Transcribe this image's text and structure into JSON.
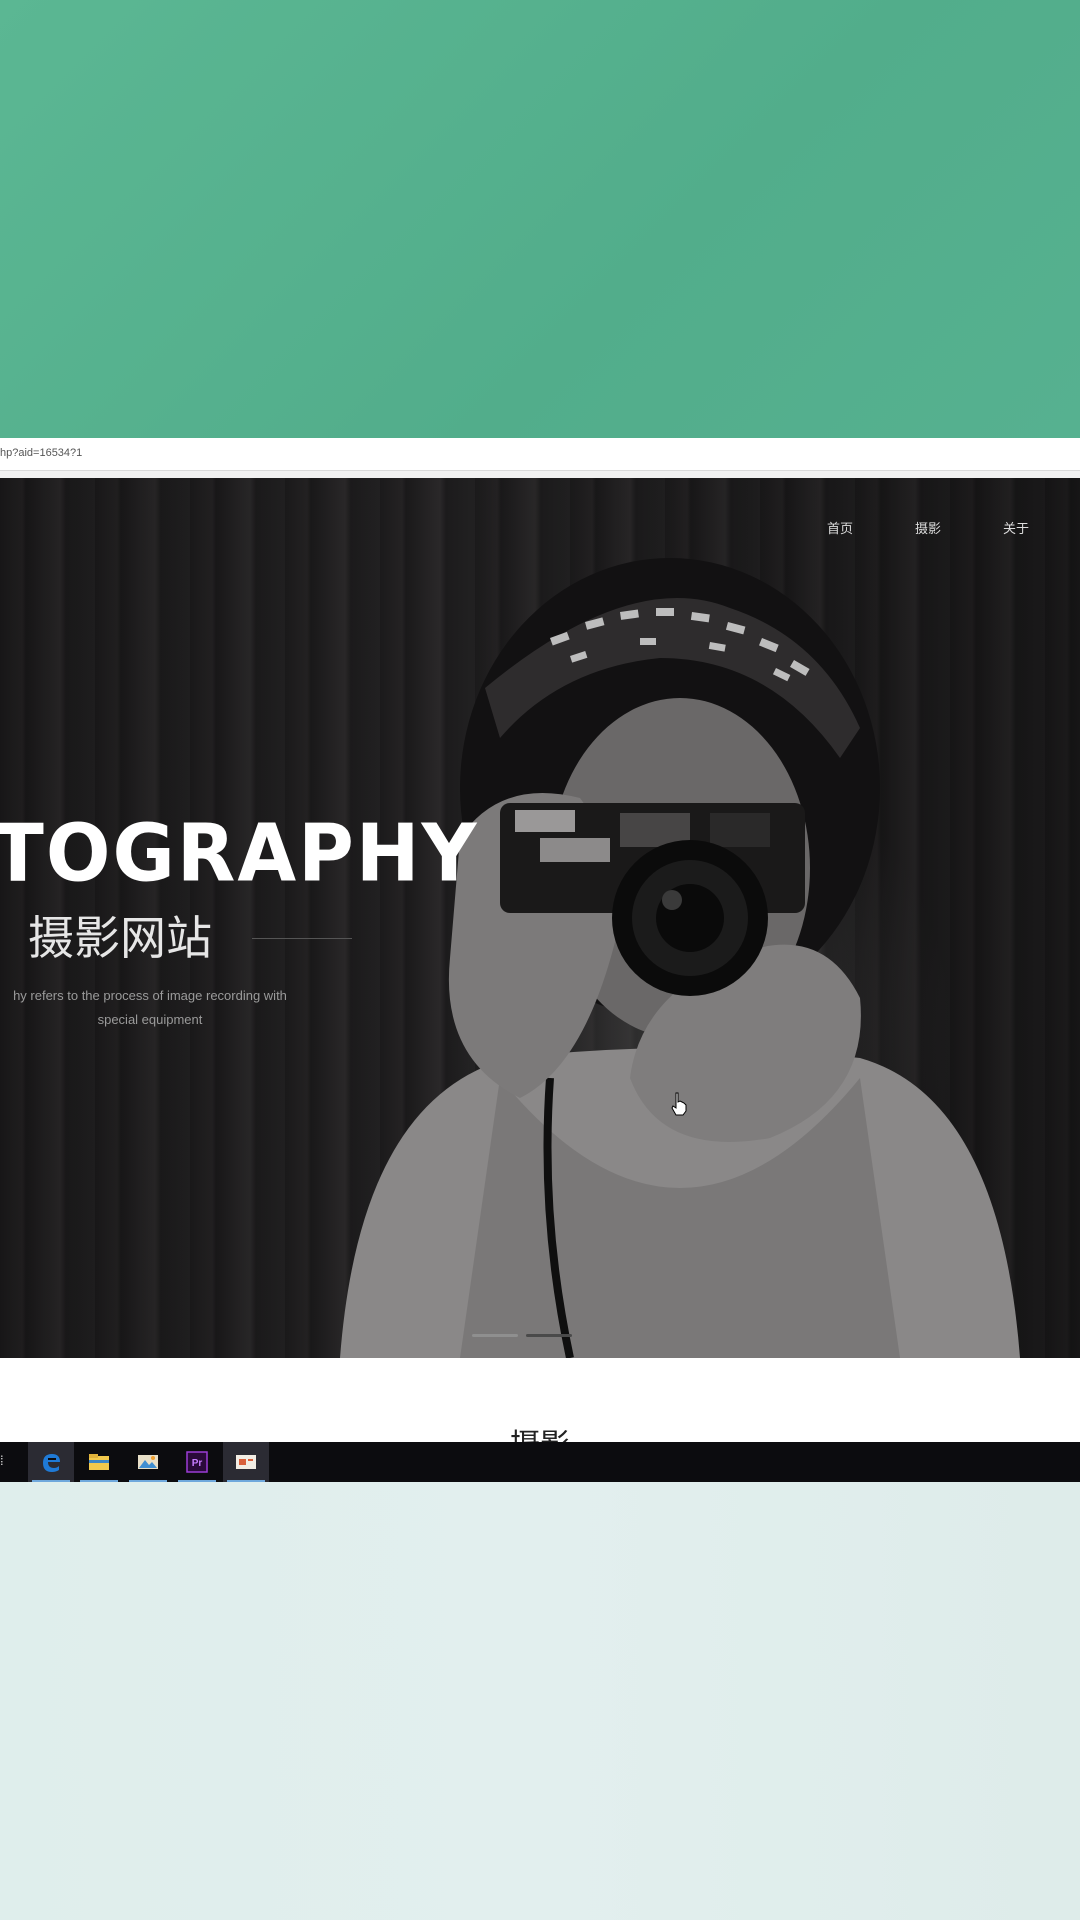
{
  "browser": {
    "status_url": "hp?aid=16534?1"
  },
  "nav": {
    "items": [
      {
        "label": "首页"
      },
      {
        "label": "摄影"
      },
      {
        "label": "关于"
      }
    ]
  },
  "hero": {
    "title": "TOGRAPHY",
    "subtitle": "摄影网站",
    "description_line1": "hy refers to the process of image recording with",
    "description_line2": "special equipment",
    "slides": 2,
    "active_slide": 1
  },
  "section": {
    "title": "摄影"
  },
  "taskbar": {
    "start_glyph": "⁞",
    "apps": [
      {
        "name": "edge-browser",
        "active": true
      },
      {
        "name": "file-explorer",
        "active": false
      },
      {
        "name": "photos",
        "active": false
      },
      {
        "name": "premiere-pro",
        "label": "Pr",
        "active": false
      },
      {
        "name": "presentation",
        "active": false
      }
    ]
  },
  "colors": {
    "top_band": "#54b08e",
    "bottom_band": "#dfeeec",
    "hero_bg": "#1d1c1d",
    "taskbar_bg": "#0c0c0f",
    "edge_blue": "#1f7ad6",
    "premiere_purple": "#9b3dd6"
  }
}
